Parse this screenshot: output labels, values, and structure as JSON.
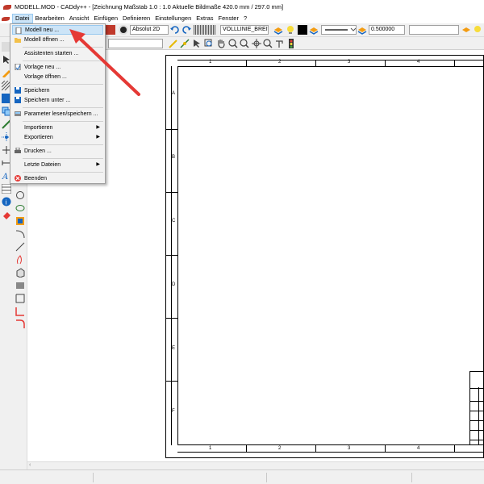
{
  "window": {
    "title": "MODELL.MOD  -  CADdy++ - [Zeichnung    Maßstab 1.0 : 1.0   Aktuelle Bildmaße 420.0 mm / 297.0 mm]"
  },
  "menubar": {
    "items": [
      "Datei",
      "Bearbeiten",
      "Ansicht",
      "Einfügen",
      "Definieren",
      "Einstellungen",
      "Extras",
      "Fenster",
      "?"
    ]
  },
  "toolbar": {
    "coord_mode": "Absolut 2D",
    "line_type": "VOLLLINIE_BREIT",
    "line_width": "0.500000",
    "text_field": ""
  },
  "file_menu": {
    "items": [
      {
        "label": "Modell neu ...",
        "submenu": false
      },
      {
        "label": "Modell öffnen ...",
        "submenu": false
      },
      {
        "label": "Assistenten starten ...",
        "submenu": false
      },
      {
        "label": "Vorlage neu ...",
        "submenu": false
      },
      {
        "label": "Vorlage öffnen ...",
        "submenu": false
      },
      {
        "label": "Speichern",
        "submenu": false
      },
      {
        "label": "Speichern unter ...",
        "submenu": false
      },
      {
        "label": "Parameter lesen/speichern ...",
        "submenu": false
      },
      {
        "label": "Importieren",
        "submenu": true
      },
      {
        "label": "Exportieren",
        "submenu": true
      },
      {
        "label": "Drucken ...",
        "submenu": false
      },
      {
        "label": "Letzte Dateien",
        "submenu": true
      },
      {
        "label": "Beenden",
        "submenu": false
      }
    ]
  },
  "drawing": {
    "col_labels": [
      "1",
      "2",
      "3",
      "4"
    ],
    "row_labels": [
      "A",
      "B",
      "C",
      "D",
      "E",
      "F"
    ]
  },
  "colors": {
    "accent_red": "#e53935",
    "highlight": "#cce4f7"
  }
}
